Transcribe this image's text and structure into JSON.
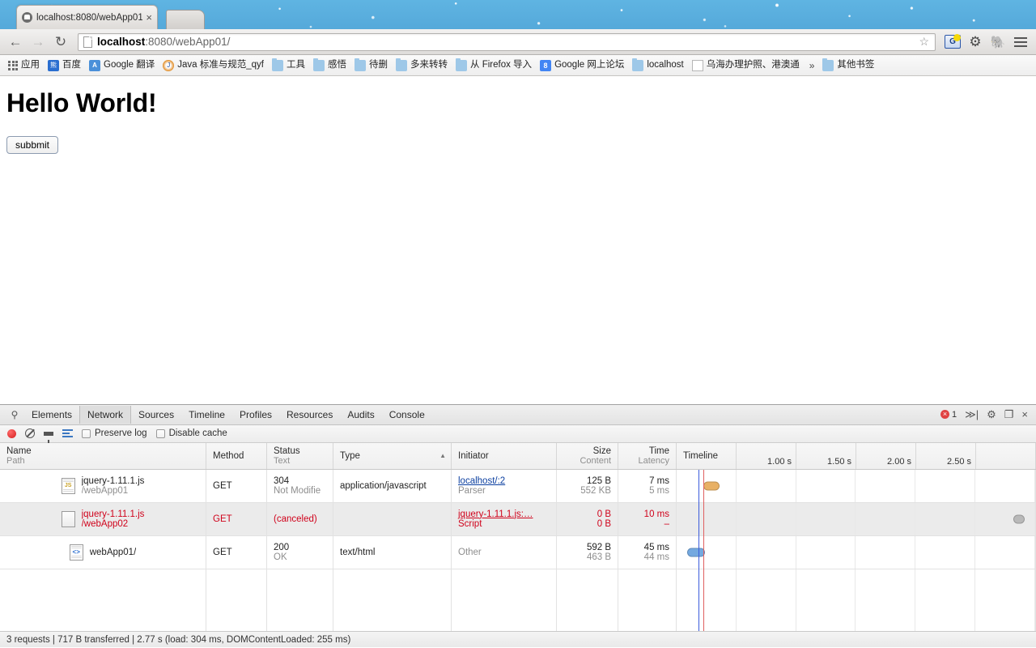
{
  "browser": {
    "tab": {
      "title": "localhost:8080/webApp01",
      "close": "×",
      "favicon": "site-favicon"
    },
    "nav": {
      "back": "←",
      "forward": "→",
      "reload": "↻"
    },
    "omnibox": {
      "url_host": "localhost",
      "url_rest": ":8080/webApp01/",
      "bookmark_star": "☆"
    },
    "toolbar_icons": [
      {
        "name": "go-extension-icon",
        "glyph": "G"
      },
      {
        "name": "gear-icon",
        "glyph": "⚙"
      },
      {
        "name": "evernote-icon",
        "glyph": "🐘"
      },
      {
        "name": "chrome-menu-icon",
        "glyph": "☰"
      }
    ],
    "bookmarks": [
      {
        "label": "应用",
        "icon": "apps-grid-icon"
      },
      {
        "label": "百度",
        "icon": "baidu-icon"
      },
      {
        "label": "Google 翻译",
        "icon": "google-translate-icon"
      },
      {
        "label": "Java 标准与规范_qyf",
        "icon": "java-icon"
      },
      {
        "label": "工具",
        "icon": "folder-icon"
      },
      {
        "label": "感悟",
        "icon": "folder-icon"
      },
      {
        "label": "待删",
        "icon": "folder-icon"
      },
      {
        "label": "多来转转",
        "icon": "folder-icon"
      },
      {
        "label": "从 Firefox 导入",
        "icon": "folder-icon"
      },
      {
        "label": "Google 网上论坛",
        "icon": "google-icon"
      },
      {
        "label": "localhost",
        "icon": "folder-icon"
      },
      {
        "label": "乌海办理护照、港澳通",
        "icon": "doc-icon"
      }
    ],
    "bookmarks_overflow": "»",
    "other_bookmarks": {
      "label": "其他书签",
      "icon": "folder-icon"
    }
  },
  "page": {
    "heading": "Hello World!",
    "button_label": "subbmit"
  },
  "devtools": {
    "tabs": [
      {
        "label": "Elements",
        "active": false
      },
      {
        "label": "Network",
        "active": true
      },
      {
        "label": "Sources",
        "active": false
      },
      {
        "label": "Timeline",
        "active": false
      },
      {
        "label": "Profiles",
        "active": false
      },
      {
        "label": "Resources",
        "active": false
      },
      {
        "label": "Audits",
        "active": false
      },
      {
        "label": "Console",
        "active": false
      }
    ],
    "search_icon": "⚲",
    "error_count": "1",
    "right_icons": [
      {
        "name": "console-drawer-icon",
        "glyph": "≫|"
      },
      {
        "name": "devtools-settings-icon",
        "glyph": "⚙"
      },
      {
        "name": "dock-side-icon",
        "glyph": "❐"
      },
      {
        "name": "close-devtools-icon",
        "glyph": "×"
      }
    ],
    "toolbar": {
      "record_title": "record-button",
      "clear_title": "clear-button",
      "filter_title": "filter-button",
      "grouping_title": "grouping-button",
      "preserve_log": "Preserve log",
      "disable_cache": "Disable cache",
      "preserve_log_checked": false,
      "disable_cache_checked": false
    },
    "columns": [
      {
        "key": "name",
        "title": "Name",
        "sub": "Path",
        "sorted": false
      },
      {
        "key": "method",
        "title": "Method",
        "sub": "",
        "sorted": false
      },
      {
        "key": "status",
        "title": "Status",
        "sub": "Text",
        "sorted": false
      },
      {
        "key": "type",
        "title": "Type",
        "sub": "",
        "sorted": true
      },
      {
        "key": "initiator",
        "title": "Initiator",
        "sub": "",
        "sorted": false
      },
      {
        "key": "size",
        "title": "Size",
        "sub": "Content",
        "sorted": false
      },
      {
        "key": "time",
        "title": "Time",
        "sub": "Latency",
        "sorted": false
      },
      {
        "key": "timeline",
        "title": "Timeline",
        "sub": "",
        "sorted": false
      }
    ],
    "sort_arrow": "▲",
    "timeline_ticks": [
      "1.00 s",
      "1.50 s",
      "2.00 s",
      "2.50 s"
    ],
    "requests": [
      {
        "name": "jquery-1.11.1.js",
        "path": "/webApp01",
        "icon": "js-file-icon",
        "method": "GET",
        "status": "304",
        "status_text": "Not Modifie",
        "type": "application/javascript",
        "initiator": "localhost/:2",
        "initiator_sub": "Parser",
        "size": "125 B",
        "size_content": "552 KB",
        "time": "7 ms",
        "latency": "5 ms",
        "error": false,
        "bar_color": "#e8b064",
        "bar_left_pct": 7.5,
        "bar_width_pct": 4.5
      },
      {
        "name": "jquery-1.11.1.js",
        "path": "/webApp02",
        "icon": "blank-file-icon",
        "method": "GET",
        "status": "(canceled)",
        "status_text": "",
        "type": "",
        "initiator": "jquery-1.11.1.js:…",
        "initiator_sub": "Script",
        "size": "0 B",
        "size_content": "0 B",
        "time": "10 ms",
        "latency": "–",
        "error": true,
        "bar_color": "#b9b9b9",
        "bar_left_pct": 94.0,
        "bar_width_pct": 3.0
      },
      {
        "name": "webApp01/",
        "path": "",
        "icon": "html-file-icon",
        "method": "GET",
        "status": "200",
        "status_text": "OK",
        "type": "text/html",
        "initiator": "",
        "initiator_sub": "Other",
        "size": "592 B",
        "size_content": "463 B",
        "time": "45 ms",
        "latency": "44 ms",
        "error": false,
        "bar_color": "#74a9e0",
        "bar_left_pct": 3.0,
        "bar_width_pct": 5.0
      }
    ],
    "event_lines": [
      {
        "name": "dom-content-loaded-line",
        "color": "#3b5bdb",
        "left_pct": 6.3
      },
      {
        "name": "load-event-line",
        "color": "#e06060",
        "left_pct": 7.6
      }
    ],
    "status_bar": "3 requests | 717 B transferred | 2.77 s (load: 304 ms, DOMContentLoaded: 255 ms)"
  },
  "colors": {
    "accent_blue": "#3b78c2",
    "error_red": "#d0021b",
    "tabstrip_blue": "#55a9da"
  }
}
